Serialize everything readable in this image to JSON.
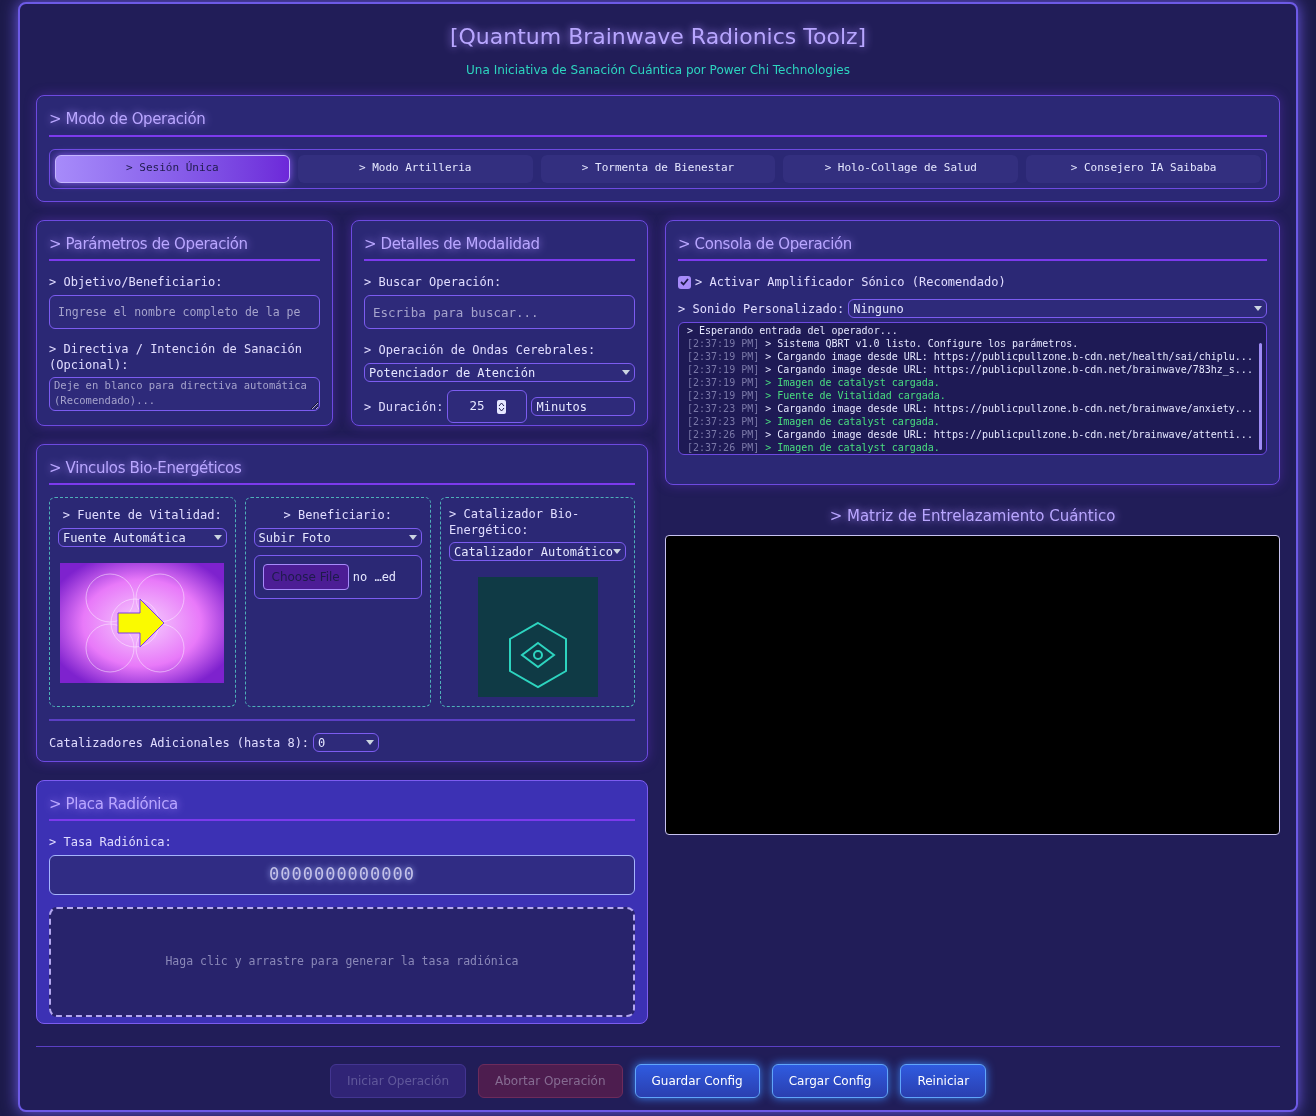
{
  "header": {
    "title": "[Quantum Brainwave Radionics Toolz]",
    "subtitle": "Una Iniciativa de Sanación Cuántica por Power Chi Technologies"
  },
  "mode_panel": {
    "title": "> Modo de Operación",
    "tabs": [
      {
        "label": "> Sesión Única",
        "selected": true
      },
      {
        "label": "> Modo Artilleria",
        "selected": false
      },
      {
        "label": "> Tormenta de Bienestar",
        "selected": false
      },
      {
        "label": "> Holo-Collage de Salud",
        "selected": false
      },
      {
        "label": "> Consejero IA Saibaba",
        "selected": false
      }
    ]
  },
  "parameters": {
    "title": "> Parámetros de Operación",
    "target_label": "> Objetivo/Beneficiario:",
    "target_placeholder": "Ingrese el nombre completo de la pe",
    "directive_label": "> Directiva / Intención de Sanación (Opcional):",
    "directive_placeholder": "Deje en blanco para directiva automática (Recomendado)..."
  },
  "modality": {
    "title": "> Detalles de Modalidad",
    "search_label": "> Buscar Operación:",
    "search_placeholder": "Escriba para buscar...",
    "brainwave_label": "> Operación de Ondas Cerebrales:",
    "brainwave_value": "Potenciador de Atención",
    "duration_label": "> Duración:",
    "duration_value": "25",
    "duration_unit": "Minutos"
  },
  "bio_links": {
    "title": "> Vinculos Bio-Energéticos",
    "columns": [
      {
        "kind": "image",
        "label": "> Fuente de Vitalidad:",
        "select": "Fuente Automática"
      },
      {
        "kind": "upload",
        "label": "> Beneficiario:",
        "select": "Subir Foto",
        "file_button": "Choose File",
        "file_status": "no …ed"
      },
      {
        "kind": "catalyst",
        "label": "> Catalizador Bio-Energético:",
        "select": "Catalizador Automático"
      }
    ],
    "additional_label": "Catalizadores Adicionales (hasta 8):",
    "additional_value": "0"
  },
  "plate": {
    "title": "> Placa Radiónica",
    "rate_label": "> Tasa Radiónica:",
    "rate_value": "0000000000000",
    "pad_hint": "Haga clic y arrastre para generar la tasa radiónica"
  },
  "console": {
    "title": "> Consola de Operación",
    "amplifier_label": "> Activar Amplificador Sónico (Recomendado)",
    "amplifier_checked": true,
    "sound_label": "> Sonido Personalizado:",
    "sound_value": "Ninguno",
    "log": [
      {
        "message": "> Esperando entrada del operador...",
        "kind": "info"
      },
      {
        "time": "[2:37:19 PM]",
        "message": "> Sistema QBRT v1.0 listo. Configure los parámetros.",
        "kind": "info"
      },
      {
        "time": "[2:37:19 PM]",
        "message": "> Cargando image desde URL: https://publicpullzone.b-cdn.net/health/sai/chiplu...",
        "kind": "info"
      },
      {
        "time": "[2:37:19 PM]",
        "message": "> Cargando image desde URL: https://publicpullzone.b-cdn.net/brainwave/783hz_s...",
        "kind": "info"
      },
      {
        "time": "[2:37:19 PM]",
        "message": "> Imagen de catalyst cargada.",
        "kind": "success"
      },
      {
        "time": "[2:37:19 PM]",
        "message": "> Fuente de Vitalidad cargada.",
        "kind": "success"
      },
      {
        "time": "[2:37:23 PM]",
        "message": "> Cargando image desde URL: https://publicpullzone.b-cdn.net/brainwave/anxiety...",
        "kind": "info"
      },
      {
        "time": "[2:37:23 PM]",
        "message": "> Imagen de catalyst cargada.",
        "kind": "success"
      },
      {
        "time": "[2:37:26 PM]",
        "message": "> Cargando image desde URL: https://publicpullzone.b-cdn.net/brainwave/attenti...",
        "kind": "info"
      },
      {
        "time": "[2:37:26 PM]",
        "message": "> Imagen de catalyst cargada.",
        "kind": "success"
      }
    ]
  },
  "matrix": {
    "title": "> Matriz de Entrelazamiento Cuántico"
  },
  "actions": [
    {
      "label": "Iniciar Operación",
      "kind": "start",
      "disabled": true
    },
    {
      "label": "Abortar Operación",
      "kind": "danger",
      "disabled": true
    },
    {
      "label": "Guardar Config",
      "kind": "primary",
      "disabled": false
    },
    {
      "label": "Cargar Config",
      "kind": "primary",
      "disabled": false
    },
    {
      "label": "Reiniciar",
      "kind": "primary",
      "disabled": false
    }
  ]
}
